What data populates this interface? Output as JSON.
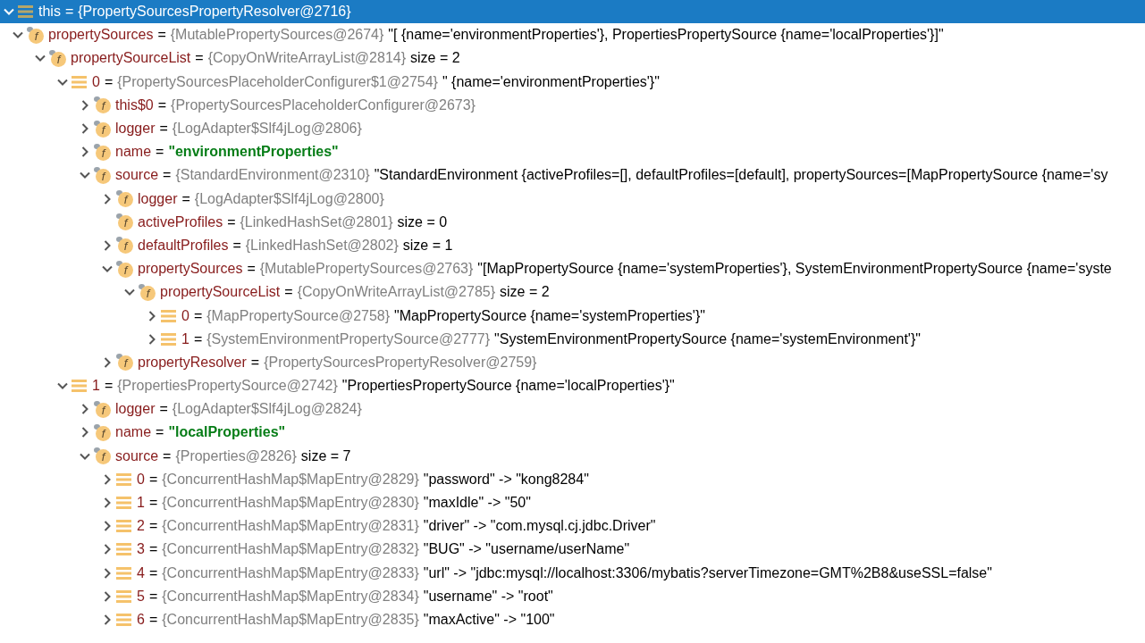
{
  "tree": [
    {
      "kind": "root",
      "name": "this",
      "op": "=",
      "type": "{PropertySourcesPropertyResolver@2716}",
      "expanded": true,
      "selected": true,
      "children": [
        {
          "kind": "field",
          "badge": "f",
          "name": "propertySources",
          "op": "=",
          "type": "{MutablePropertySources@2674}",
          "value": "\"[ {name='environmentProperties'}, PropertiesPropertySource {name='localProperties'}]\"",
          "expanded": true,
          "selected": false,
          "children": [
            {
              "kind": "field",
              "badge": "f",
              "name": "propertySourceList",
              "op": "=",
              "type": "{CopyOnWriteArrayList@2814}",
              "value": "size = 2",
              "expanded": true,
              "selected": false,
              "children": [
                {
                  "kind": "element",
                  "name": "0",
                  "op": "=",
                  "type": "{PropertySourcesPlaceholderConfigurer$1@2754}",
                  "value": "\" {name='environmentProperties'}\"",
                  "expanded": true,
                  "selected": false,
                  "children": [
                    {
                      "kind": "field",
                      "badge": "f",
                      "name": "this$0",
                      "op": "=",
                      "type": "{PropertySourcesPlaceholderConfigurer@2673}",
                      "expanded": false,
                      "selected": false
                    },
                    {
                      "kind": "field",
                      "badge": "f",
                      "name": "logger",
                      "op": "=",
                      "type": "{LogAdapter$Slf4jLog@2806}",
                      "expanded": false,
                      "selected": false
                    },
                    {
                      "kind": "field",
                      "badge": "f",
                      "name": "name",
                      "op": "=",
                      "string": "\"environmentProperties\"",
                      "expanded": false,
                      "selected": false
                    },
                    {
                      "kind": "field",
                      "badge": "f",
                      "name": "source",
                      "op": "=",
                      "type": "{StandardEnvironment@2310}",
                      "value": "\"StandardEnvironment {activeProfiles=[], defaultProfiles=[default], propertySources=[MapPropertySource {name='sy",
                      "expanded": true,
                      "selected": false,
                      "children": [
                        {
                          "kind": "field",
                          "badge": "f",
                          "name": "logger",
                          "op": "=",
                          "type": "{LogAdapter$Slf4jLog@2800}",
                          "expanded": false,
                          "selected": false
                        },
                        {
                          "kind": "field",
                          "badge": "f",
                          "name": "activeProfiles",
                          "op": "=",
                          "type": "{LinkedHashSet@2801}",
                          "value": "size = 0",
                          "selected": false
                        },
                        {
                          "kind": "field",
                          "badge": "f",
                          "name": "defaultProfiles",
                          "op": "=",
                          "type": "{LinkedHashSet@2802}",
                          "value": "size = 1",
                          "expanded": false,
                          "selected": false
                        },
                        {
                          "kind": "field",
                          "badge": "f",
                          "name": "propertySources",
                          "op": "=",
                          "type": "{MutablePropertySources@2763}",
                          "value": "\"[MapPropertySource {name='systemProperties'}, SystemEnvironmentPropertySource {name='syste",
                          "expanded": true,
                          "selected": false,
                          "children": [
                            {
                              "kind": "field",
                              "badge": "f",
                              "name": "propertySourceList",
                              "op": "=",
                              "type": "{CopyOnWriteArrayList@2785}",
                              "value": "size = 2",
                              "expanded": true,
                              "selected": false,
                              "children": [
                                {
                                  "kind": "element",
                                  "name": "0",
                                  "op": "=",
                                  "type": "{MapPropertySource@2758}",
                                  "value": "\"MapPropertySource {name='systemProperties'}\"",
                                  "expanded": false,
                                  "selected": false
                                },
                                {
                                  "kind": "element",
                                  "name": "1",
                                  "op": "=",
                                  "type": "{SystemEnvironmentPropertySource@2777}",
                                  "value": "\"SystemEnvironmentPropertySource {name='systemEnvironment'}\"",
                                  "expanded": false,
                                  "selected": false
                                }
                              ]
                            }
                          ]
                        },
                        {
                          "kind": "field",
                          "badge": "f",
                          "name": "propertyResolver",
                          "op": "=",
                          "type": "{PropertySourcesPropertyResolver@2759}",
                          "expanded": false,
                          "selected": false
                        }
                      ]
                    }
                  ]
                },
                {
                  "kind": "element",
                  "name": "1",
                  "op": "=",
                  "type": "{PropertiesPropertySource@2742}",
                  "value": "\"PropertiesPropertySource {name='localProperties'}\"",
                  "expanded": true,
                  "selected": false,
                  "children": [
                    {
                      "kind": "field",
                      "badge": "f",
                      "name": "logger",
                      "op": "=",
                      "type": "{LogAdapter$Slf4jLog@2824}",
                      "expanded": false,
                      "selected": false
                    },
                    {
                      "kind": "field",
                      "badge": "f",
                      "name": "name",
                      "op": "=",
                      "string": "\"localProperties\"",
                      "expanded": false,
                      "selected": false
                    },
                    {
                      "kind": "field",
                      "badge": "f",
                      "name": "source",
                      "op": "=",
                      "type": "{Properties@2826}",
                      "value": "size = 7",
                      "expanded": true,
                      "selected": false,
                      "children": [
                        {
                          "kind": "element",
                          "name": "0",
                          "op": "=",
                          "type": "{ConcurrentHashMap$MapEntry@2829}",
                          "value": "\"password\" -> \"kong8284\"",
                          "expanded": false,
                          "selected": false
                        },
                        {
                          "kind": "element",
                          "name": "1",
                          "op": "=",
                          "type": "{ConcurrentHashMap$MapEntry@2830}",
                          "value": "\"maxIdle\" -> \"50\"",
                          "expanded": false,
                          "selected": false
                        },
                        {
                          "kind": "element",
                          "name": "2",
                          "op": "=",
                          "type": "{ConcurrentHashMap$MapEntry@2831}",
                          "value": "\"driver\" -> \"com.mysql.cj.jdbc.Driver\"",
                          "expanded": false,
                          "selected": false
                        },
                        {
                          "kind": "element",
                          "name": "3",
                          "op": "=",
                          "type": "{ConcurrentHashMap$MapEntry@2832}",
                          "value": "\"BUG\" -> \"username/userName\"",
                          "expanded": false,
                          "selected": false
                        },
                        {
                          "kind": "element",
                          "name": "4",
                          "op": "=",
                          "type": "{ConcurrentHashMap$MapEntry@2833}",
                          "value": "\"url\" -> \"jdbc:mysql://localhost:3306/mybatis?serverTimezone=GMT%2B8&useSSL=false\"",
                          "expanded": false,
                          "selected": false
                        },
                        {
                          "kind": "element",
                          "name": "5",
                          "op": "=",
                          "type": "{ConcurrentHashMap$MapEntry@2834}",
                          "value": "\"username\" -> \"root\"",
                          "expanded": false,
                          "selected": false
                        },
                        {
                          "kind": "element",
                          "name": "6",
                          "op": "=",
                          "type": "{ConcurrentHashMap$MapEntry@2835}",
                          "value": "\"maxActive\" -> \"100\"",
                          "expanded": false,
                          "selected": false
                        }
                      ]
                    }
                  ]
                }
              ]
            }
          ]
        }
      ]
    }
  ]
}
